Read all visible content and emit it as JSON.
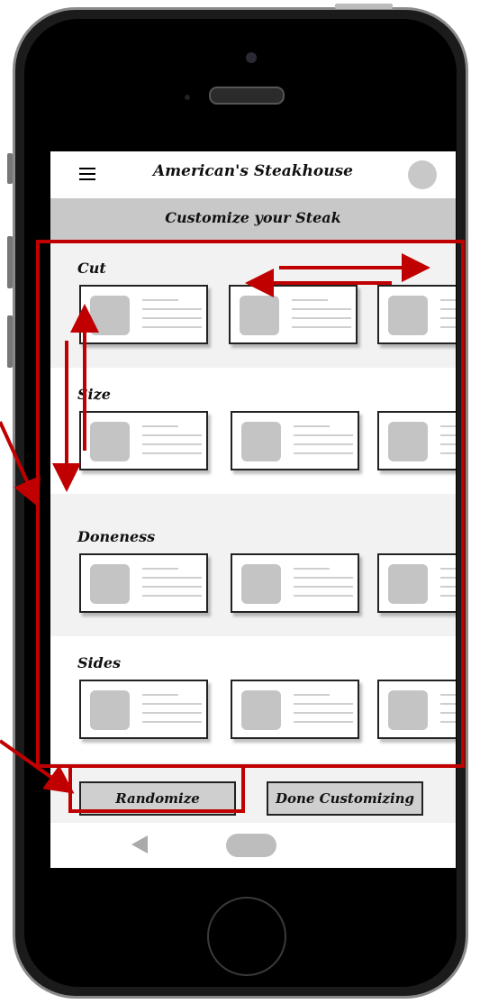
{
  "app": {
    "title": "American's Steakhouse",
    "subtitle": "Customize your Steak"
  },
  "sections": [
    {
      "label": "Cut"
    },
    {
      "label": "Size"
    },
    {
      "label": "Doneness"
    },
    {
      "label": "Sides"
    }
  ],
  "actions": {
    "randomize_label": "Randomize",
    "done_label": "Done Customizing"
  },
  "icons": {
    "menu": "hamburger-icon",
    "avatar": "avatar-icon",
    "back": "back-triangle-icon",
    "home": "home-pill-icon"
  },
  "colors": {
    "annotation": "#c00000",
    "subbar": "#c8c8c8",
    "button_fill": "#cfcfcf"
  }
}
